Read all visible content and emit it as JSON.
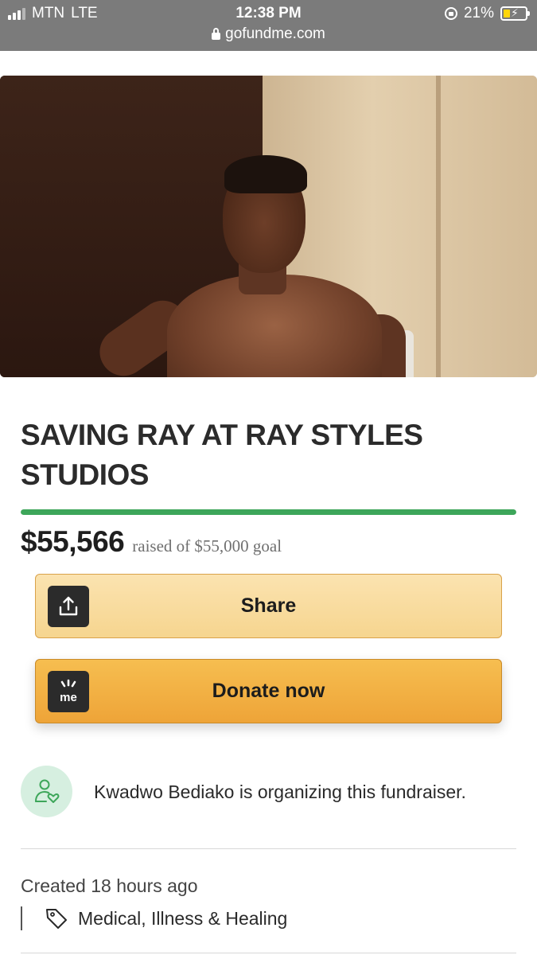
{
  "status_bar": {
    "carrier": "MTN",
    "network": "LTE",
    "time": "12:38 PM",
    "battery": "21%",
    "url": "gofundme.com"
  },
  "fundraiser": {
    "title": "SAVING RAY AT RAY STYLES STUDIOS",
    "raised_amount": "$55,566",
    "raised_text": "raised of $55,000 goal",
    "progress_fraction": 1.0
  },
  "actions": {
    "share_label": "Share",
    "donate_label": "Donate now",
    "donate_icon_text": "me"
  },
  "organizer": {
    "text": "Kwadwo Bediako is organizing this fundraiser."
  },
  "meta": {
    "created": "Created 18 hours ago",
    "category": "Medical, Illness & Healing"
  },
  "colors": {
    "progress": "#3da65a",
    "share_button": "#f6d58f",
    "donate_button": "#eea438",
    "organizer_avatar_bg": "#d6efe0"
  },
  "icons": {
    "share": "share-upload-icon",
    "donate": "gofundme-logo-icon",
    "organizer": "person-heart-icon",
    "category": "tag-icon"
  }
}
